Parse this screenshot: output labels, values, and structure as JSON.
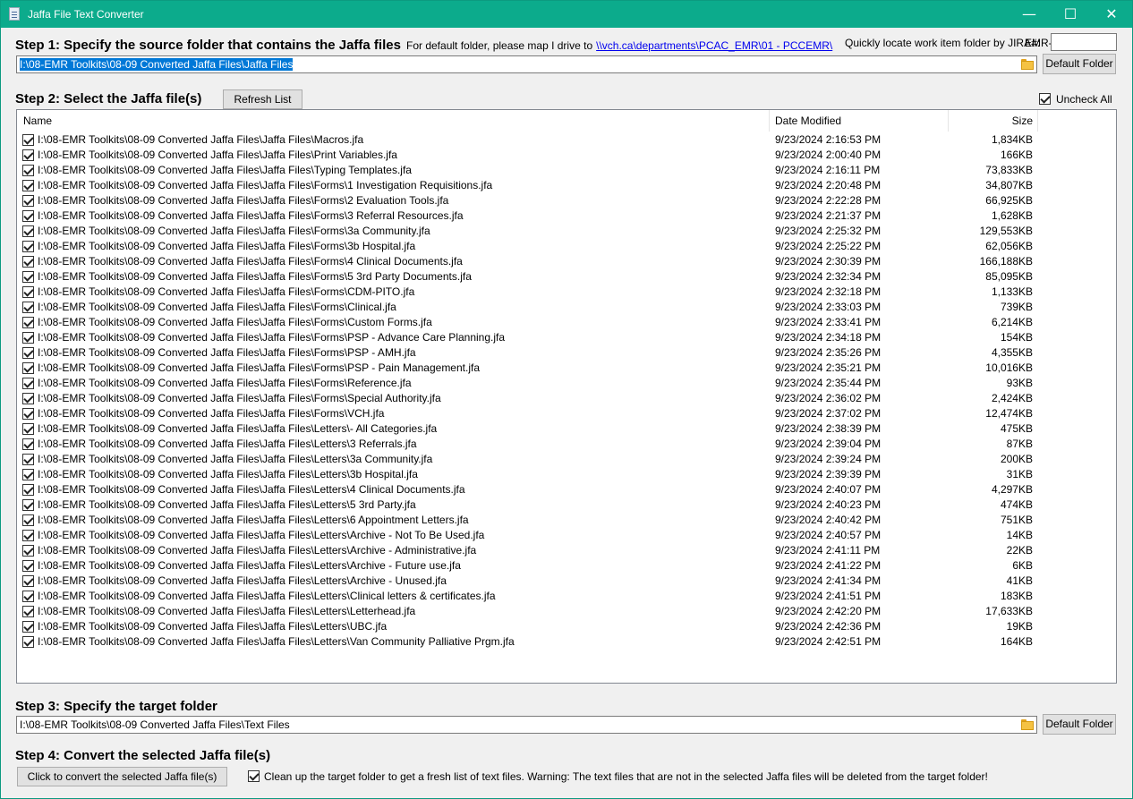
{
  "window": {
    "title": "Jaffa File Text Converter",
    "minimize_glyph": "—",
    "maximize_glyph": "☐",
    "close_glyph": "✕"
  },
  "step1": {
    "heading": "Step 1: Specify the source folder that contains the Jaffa files",
    "note": "For default folder, please map I drive to",
    "link": "\\\\vch.ca\\departments\\PCAC_EMR\\01 - PCCEMR\\",
    "jira_label": "Quickly locate work item folder by JIRA#:",
    "jira_prefix": "EMR-",
    "jira_value": "",
    "source_path": "I:\\08-EMR Toolkits\\08-09 Converted Jaffa Files\\Jaffa Files",
    "default_folder_label": "Default Folder"
  },
  "step2": {
    "heading": "Step 2: Select the Jaffa file(s)",
    "refresh_label": "Refresh List",
    "uncheck_all_label": "Uncheck All",
    "columns": {
      "name": "Name",
      "date": "Date Modified",
      "size": "Size"
    },
    "files": [
      {
        "name": "I:\\08-EMR Toolkits\\08-09 Converted Jaffa Files\\Jaffa Files\\Macros.jfa",
        "date": "9/23/2024 2:16:53 PM",
        "size": "1,834KB"
      },
      {
        "name": "I:\\08-EMR Toolkits\\08-09 Converted Jaffa Files\\Jaffa Files\\Print Variables.jfa",
        "date": "9/23/2024 2:00:40 PM",
        "size": "166KB"
      },
      {
        "name": "I:\\08-EMR Toolkits\\08-09 Converted Jaffa Files\\Jaffa Files\\Typing Templates.jfa",
        "date": "9/23/2024 2:16:11 PM",
        "size": "73,833KB"
      },
      {
        "name": "I:\\08-EMR Toolkits\\08-09 Converted Jaffa Files\\Jaffa Files\\Forms\\1 Investigation Requisitions.jfa",
        "date": "9/23/2024 2:20:48 PM",
        "size": "34,807KB"
      },
      {
        "name": "I:\\08-EMR Toolkits\\08-09 Converted Jaffa Files\\Jaffa Files\\Forms\\2 Evaluation Tools.jfa",
        "date": "9/23/2024 2:22:28 PM",
        "size": "66,925KB"
      },
      {
        "name": "I:\\08-EMR Toolkits\\08-09 Converted Jaffa Files\\Jaffa Files\\Forms\\3 Referral Resources.jfa",
        "date": "9/23/2024 2:21:37 PM",
        "size": "1,628KB"
      },
      {
        "name": "I:\\08-EMR Toolkits\\08-09 Converted Jaffa Files\\Jaffa Files\\Forms\\3a Community.jfa",
        "date": "9/23/2024 2:25:32 PM",
        "size": "129,553KB"
      },
      {
        "name": "I:\\08-EMR Toolkits\\08-09 Converted Jaffa Files\\Jaffa Files\\Forms\\3b Hospital.jfa",
        "date": "9/23/2024 2:25:22 PM",
        "size": "62,056KB"
      },
      {
        "name": "I:\\08-EMR Toolkits\\08-09 Converted Jaffa Files\\Jaffa Files\\Forms\\4 Clinical Documents.jfa",
        "date": "9/23/2024 2:30:39 PM",
        "size": "166,188KB"
      },
      {
        "name": "I:\\08-EMR Toolkits\\08-09 Converted Jaffa Files\\Jaffa Files\\Forms\\5 3rd Party Documents.jfa",
        "date": "9/23/2024 2:32:34 PM",
        "size": "85,095KB"
      },
      {
        "name": "I:\\08-EMR Toolkits\\08-09 Converted Jaffa Files\\Jaffa Files\\Forms\\CDM-PITO.jfa",
        "date": "9/23/2024 2:32:18 PM",
        "size": "1,133KB"
      },
      {
        "name": "I:\\08-EMR Toolkits\\08-09 Converted Jaffa Files\\Jaffa Files\\Forms\\Clinical.jfa",
        "date": "9/23/2024 2:33:03 PM",
        "size": "739KB"
      },
      {
        "name": "I:\\08-EMR Toolkits\\08-09 Converted Jaffa Files\\Jaffa Files\\Forms\\Custom Forms.jfa",
        "date": "9/23/2024 2:33:41 PM",
        "size": "6,214KB"
      },
      {
        "name": "I:\\08-EMR Toolkits\\08-09 Converted Jaffa Files\\Jaffa Files\\Forms\\PSP - Advance Care Planning.jfa",
        "date": "9/23/2024 2:34:18 PM",
        "size": "154KB"
      },
      {
        "name": "I:\\08-EMR Toolkits\\08-09 Converted Jaffa Files\\Jaffa Files\\Forms\\PSP - AMH.jfa",
        "date": "9/23/2024 2:35:26 PM",
        "size": "4,355KB"
      },
      {
        "name": "I:\\08-EMR Toolkits\\08-09 Converted Jaffa Files\\Jaffa Files\\Forms\\PSP - Pain Management.jfa",
        "date": "9/23/2024 2:35:21 PM",
        "size": "10,016KB"
      },
      {
        "name": "I:\\08-EMR Toolkits\\08-09 Converted Jaffa Files\\Jaffa Files\\Forms\\Reference.jfa",
        "date": "9/23/2024 2:35:44 PM",
        "size": "93KB"
      },
      {
        "name": "I:\\08-EMR Toolkits\\08-09 Converted Jaffa Files\\Jaffa Files\\Forms\\Special Authority.jfa",
        "date": "9/23/2024 2:36:02 PM",
        "size": "2,424KB"
      },
      {
        "name": "I:\\08-EMR Toolkits\\08-09 Converted Jaffa Files\\Jaffa Files\\Forms\\VCH.jfa",
        "date": "9/23/2024 2:37:02 PM",
        "size": "12,474KB"
      },
      {
        "name": "I:\\08-EMR Toolkits\\08-09 Converted Jaffa Files\\Jaffa Files\\Letters\\- All Categories.jfa",
        "date": "9/23/2024 2:38:39 PM",
        "size": "475KB"
      },
      {
        "name": "I:\\08-EMR Toolkits\\08-09 Converted Jaffa Files\\Jaffa Files\\Letters\\3 Referrals.jfa",
        "date": "9/23/2024 2:39:04 PM",
        "size": "87KB"
      },
      {
        "name": "I:\\08-EMR Toolkits\\08-09 Converted Jaffa Files\\Jaffa Files\\Letters\\3a Community.jfa",
        "date": "9/23/2024 2:39:24 PM",
        "size": "200KB"
      },
      {
        "name": "I:\\08-EMR Toolkits\\08-09 Converted Jaffa Files\\Jaffa Files\\Letters\\3b Hospital.jfa",
        "date": "9/23/2024 2:39:39 PM",
        "size": "31KB"
      },
      {
        "name": "I:\\08-EMR Toolkits\\08-09 Converted Jaffa Files\\Jaffa Files\\Letters\\4 Clinical Documents.jfa",
        "date": "9/23/2024 2:40:07 PM",
        "size": "4,297KB"
      },
      {
        "name": "I:\\08-EMR Toolkits\\08-09 Converted Jaffa Files\\Jaffa Files\\Letters\\5 3rd Party.jfa",
        "date": "9/23/2024 2:40:23 PM",
        "size": "474KB"
      },
      {
        "name": "I:\\08-EMR Toolkits\\08-09 Converted Jaffa Files\\Jaffa Files\\Letters\\6 Appointment Letters.jfa",
        "date": "9/23/2024 2:40:42 PM",
        "size": "751KB"
      },
      {
        "name": "I:\\08-EMR Toolkits\\08-09 Converted Jaffa Files\\Jaffa Files\\Letters\\Archive -  Not To Be Used.jfa",
        "date": "9/23/2024 2:40:57 PM",
        "size": "14KB"
      },
      {
        "name": "I:\\08-EMR Toolkits\\08-09 Converted Jaffa Files\\Jaffa Files\\Letters\\Archive - Administrative.jfa",
        "date": "9/23/2024 2:41:11 PM",
        "size": "22KB"
      },
      {
        "name": "I:\\08-EMR Toolkits\\08-09 Converted Jaffa Files\\Jaffa Files\\Letters\\Archive - Future use.jfa",
        "date": "9/23/2024 2:41:22 PM",
        "size": "6KB"
      },
      {
        "name": "I:\\08-EMR Toolkits\\08-09 Converted Jaffa Files\\Jaffa Files\\Letters\\Archive - Unused.jfa",
        "date": "9/23/2024 2:41:34 PM",
        "size": "41KB"
      },
      {
        "name": "I:\\08-EMR Toolkits\\08-09 Converted Jaffa Files\\Jaffa Files\\Letters\\Clinical letters & certificates.jfa",
        "date": "9/23/2024 2:41:51 PM",
        "size": "183KB"
      },
      {
        "name": "I:\\08-EMR Toolkits\\08-09 Converted Jaffa Files\\Jaffa Files\\Letters\\Letterhead.jfa",
        "date": "9/23/2024 2:42:20 PM",
        "size": "17,633KB"
      },
      {
        "name": "I:\\08-EMR Toolkits\\08-09 Converted Jaffa Files\\Jaffa Files\\Letters\\UBC.jfa",
        "date": "9/23/2024 2:42:36 PM",
        "size": "19KB"
      },
      {
        "name": "I:\\08-EMR Toolkits\\08-09 Converted Jaffa Files\\Jaffa Files\\Letters\\Van Community Palliative Prgm.jfa",
        "date": "9/23/2024 2:42:51 PM",
        "size": "164KB"
      }
    ]
  },
  "step3": {
    "heading": "Step 3: Specify the target folder",
    "target_path": "I:\\08-EMR Toolkits\\08-09 Converted Jaffa Files\\Text Files",
    "default_folder_label": "Default Folder"
  },
  "step4": {
    "heading": "Step 4: Convert the selected Jaffa file(s)",
    "convert_label": "Click to convert the selected Jaffa file(s)",
    "cleanup_label": "Clean up the target folder to get a fresh list of text files. Warning: The text files that are not in the selected Jaffa files will be deleted from the target folder!"
  }
}
